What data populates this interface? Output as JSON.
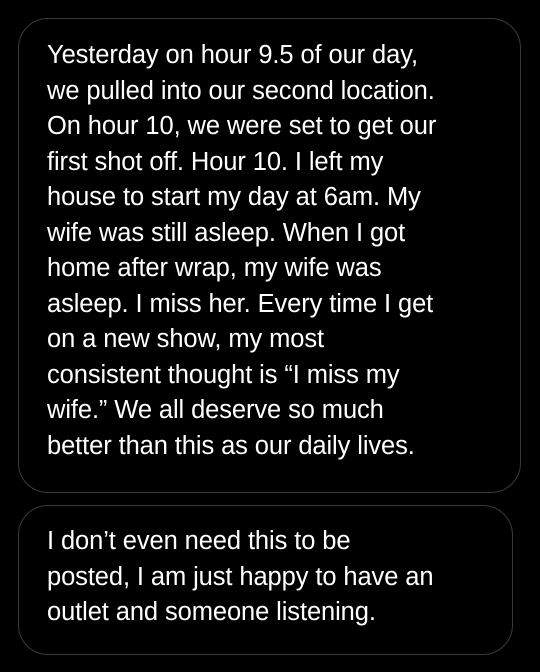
{
  "messages": [
    {
      "text": "Yesterday on hour 9.5 of our day,\nwe pulled into our second location.\nOn hour 10, we were set to get our\nfirst shot off. Hour 10. I left my\nhouse to start my day at 6am. My\nwife was still asleep. When I got\nhome after wrap, my wife was\nasleep. I miss her. Every time I get\non a new show, my most\nconsistent thought is “I miss my\nwife.” We all deserve so much\nbetter than this as our daily lives."
    },
    {
      "text": "I don’t even need this to be\nposted, I am just happy to have an\noutlet and someone listening."
    }
  ],
  "colors": {
    "background": "#000000",
    "bubble_border": "#3a3a3c",
    "text": "#ffffff"
  }
}
